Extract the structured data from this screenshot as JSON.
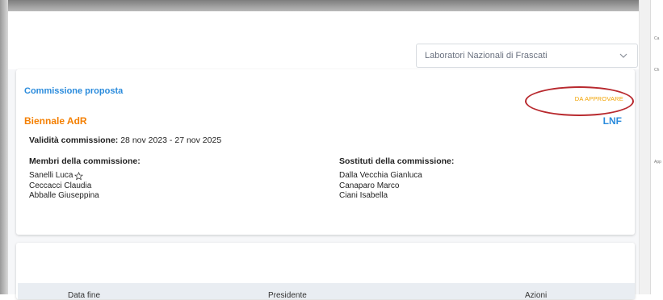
{
  "header": {
    "site_select": {
      "value": "Laboratori Nazionali di Frascati"
    }
  },
  "commission": {
    "title": "Commissione proposta",
    "status": "DA APPROVARE",
    "type": "Biennale AdR",
    "site": "LNF",
    "validity_label": "Validità commissione:",
    "validity_value": "28 nov 2023 - 27 nov 2025",
    "members_heading": "Membri della commissione:",
    "members": [
      "Sanelli Luca",
      "Ceccacci Claudia",
      "Abballe Giuseppina"
    ],
    "substitutes_heading": "Sostituti della commissione:",
    "substitutes": [
      "Dalla Vecchia Gianluca",
      "Canaparo Marco",
      "Ciani Isabella"
    ]
  },
  "table": {
    "columns": [
      "Data fine",
      "Presidente",
      "Azioni"
    ]
  },
  "side_panel": {
    "labels": [
      "Ca",
      "Ch",
      "App"
    ]
  },
  "colors": {
    "title_blue": "#2a8bdc",
    "status_orange": "#f2a200",
    "type_orange": "#f47f00",
    "highlight_ring": "#b8292e"
  },
  "icons": {
    "chevron": "chevron-down-icon",
    "star": "star-outline-icon"
  }
}
